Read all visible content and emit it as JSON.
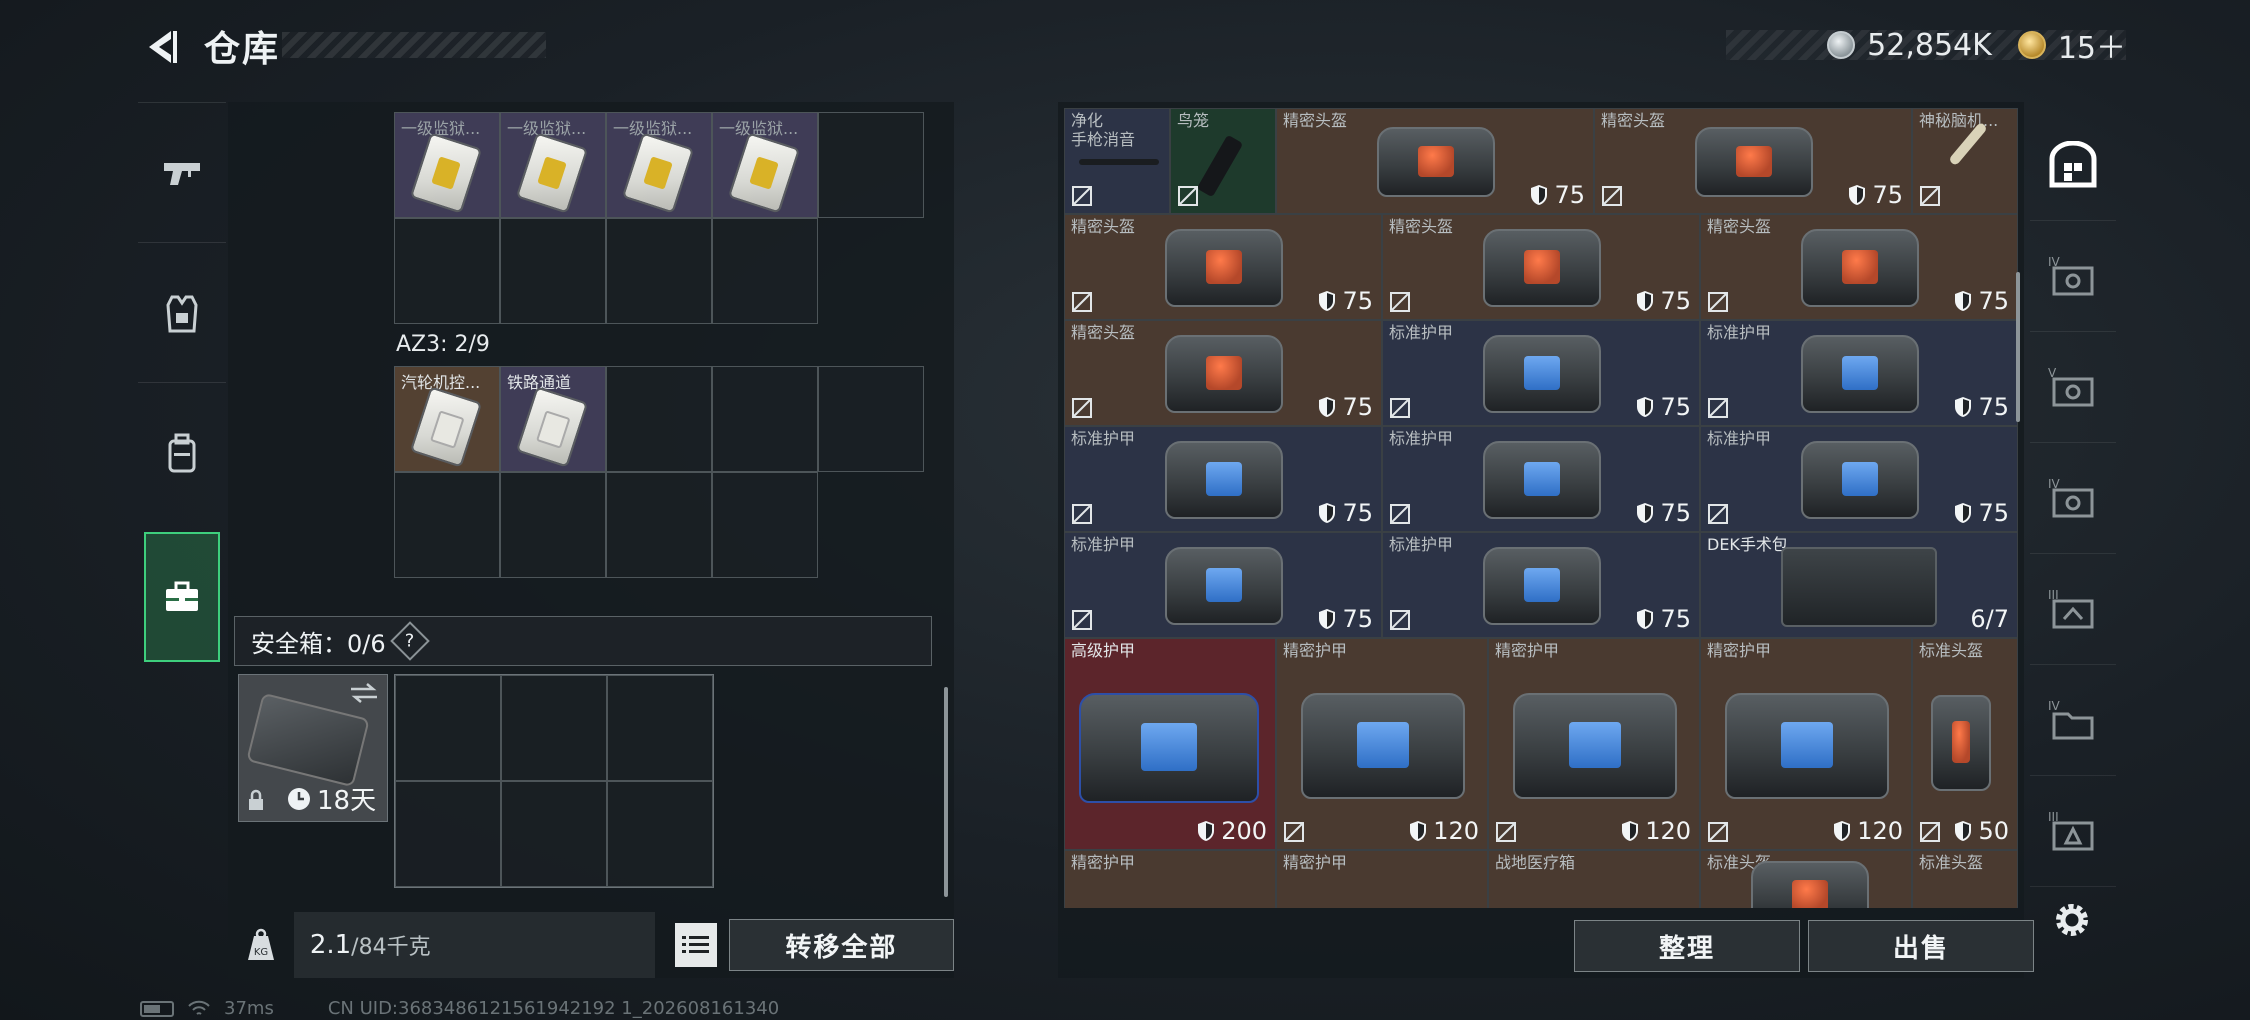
{
  "header": {
    "title": "仓库",
    "currency_silver": "52,854K",
    "currency_gold": "15＋"
  },
  "left": {
    "row1_labels": [
      "一级监狱...",
      "一级监狱...",
      "一级监狱...",
      "一级监狱..."
    ],
    "az3_label": "AZ3: 2/9",
    "az3_items": [
      "汽轮机控...",
      "铁路通道"
    ],
    "safebox_label": "安全箱：0/6",
    "safebox_help": "?",
    "safebox_timer": "18天",
    "weight_value": "2.1",
    "weight_capacity": "/84千克",
    "transfer_all": "转移全部"
  },
  "inventory": {
    "row1": [
      {
        "label": "净化\n手枪消音",
        "color": "navy"
      },
      {
        "label": "鸟笼",
        "color": "green"
      },
      {
        "label": "精密头盔",
        "value": "75",
        "color": "brown"
      },
      {
        "label": "精密头盔",
        "value": "75",
        "color": "brown"
      },
      {
        "label": "神秘脑机...",
        "color": "brown"
      }
    ],
    "labels": {
      "precise_helmet": "精密头盔",
      "std_armor": "标准护甲",
      "precise_armor": "精密护甲",
      "adv_armor": "高级护甲",
      "std_helmet": "标准头盔",
      "field_med": "战地医疗箱",
      "dek_kit": "DEK手术包"
    },
    "values": {
      "v75": "75",
      "v200": "200",
      "v120": "120",
      "v50": "50",
      "dek_uses": "6/7"
    },
    "sort_button": "整理",
    "sell_button": "出售"
  },
  "status": {
    "ping": "37ms",
    "uid": "CN UID:3683486121561942192 1_202608161340"
  },
  "colors": {
    "accent_green": "#3ecf7d",
    "brown_cell": "#4a3a30",
    "navy_cell": "#2c3346",
    "red_cell": "#5c252b"
  },
  "icons": [
    "back-arrow-icon",
    "silver-coin-icon",
    "gold-coin-icon",
    "pistol-icon",
    "vest-icon",
    "backpack-icon",
    "toolbox-icon",
    "lock-icon",
    "clock-icon",
    "swap-icon",
    "weight-icon",
    "list-icon",
    "shield-icon",
    "no-found-icon",
    "stash-icon",
    "gear-icon"
  ]
}
